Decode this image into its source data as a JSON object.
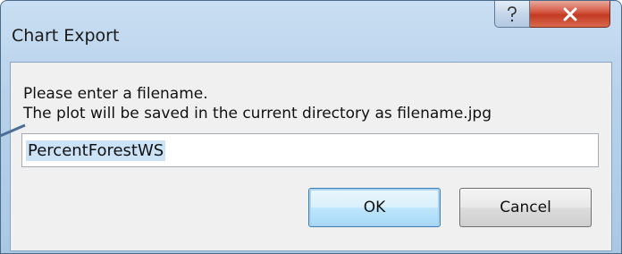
{
  "window": {
    "title": "Chart Export",
    "help_label": "?",
    "close_label": "x"
  },
  "message": {
    "line1": "Please enter a filename.",
    "line2": "The plot will be saved in the current directory as filename.jpg"
  },
  "filename_input": {
    "value": "PercentForestWS"
  },
  "buttons": {
    "ok_label": "OK",
    "cancel_label": "Cancel"
  },
  "colors": {
    "close_button": "#c23a22",
    "ok_button_border": "#3c7fb1",
    "selection_highlight": "#cce3f7"
  }
}
